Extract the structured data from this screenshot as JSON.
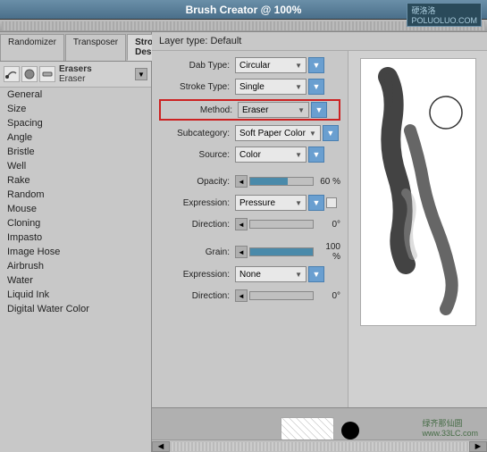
{
  "titleBar": {
    "title": "Brush Creator @ 100%",
    "logo": "硬洛洛\nPOLUOLUO.COM"
  },
  "tabs": [
    {
      "label": "Randomizer",
      "active": false
    },
    {
      "label": "Transposer",
      "active": false
    },
    {
      "label": "Stroke Designer",
      "active": true
    }
  ],
  "brushSelector": {
    "category": "Erasers",
    "name": "Eraser"
  },
  "categories": [
    {
      "label": "General",
      "selected": false
    },
    {
      "label": "Size",
      "selected": false
    },
    {
      "label": "Spacing",
      "selected": false
    },
    {
      "label": "Angle",
      "selected": false
    },
    {
      "label": "Bristle",
      "selected": false
    },
    {
      "label": "Well",
      "selected": false
    },
    {
      "label": "Rake",
      "selected": false
    },
    {
      "label": "Random",
      "selected": false
    },
    {
      "label": "Mouse",
      "selected": false
    },
    {
      "label": "Cloning",
      "selected": false
    },
    {
      "label": "Impasto",
      "selected": false
    },
    {
      "label": "Image Hose",
      "selected": false
    },
    {
      "label": "Airbrush",
      "selected": false
    },
    {
      "label": "Water",
      "selected": false
    },
    {
      "label": "Liquid Ink",
      "selected": false
    },
    {
      "label": "Digital Water Color",
      "selected": false
    }
  ],
  "controls": {
    "layerType": "Layer type: Default",
    "dabType": {
      "label": "Dab Type:",
      "value": "Circular"
    },
    "strokeType": {
      "label": "Stroke Type:",
      "value": "Single"
    },
    "method": {
      "label": "Method:",
      "value": "Eraser"
    },
    "subcategory": {
      "label": "Subcategory:",
      "value": "Soft Paper Color"
    },
    "source": {
      "label": "Source:",
      "value": "Color"
    },
    "opacity": {
      "label": "Opacity:",
      "value": "60 %",
      "percent": 60
    },
    "expression1": {
      "label": "Expression:",
      "value": "Pressure"
    },
    "direction1": {
      "label": "Direction:",
      "value": "0°"
    },
    "grain": {
      "label": "Grain:",
      "value": "100 %",
      "percent": 100
    },
    "expression2": {
      "label": "Expression:",
      "value": "None"
    },
    "direction2": {
      "label": "Direction:",
      "value": "0°"
    }
  },
  "bottomBar": {
    "watermark1": "绿齐那仙圆",
    "watermark2": "www.33LC.com"
  },
  "icons": {
    "dropdownArrow": "▼",
    "leftArrow": "◄",
    "rightArrow": "►",
    "checkmark": ""
  }
}
